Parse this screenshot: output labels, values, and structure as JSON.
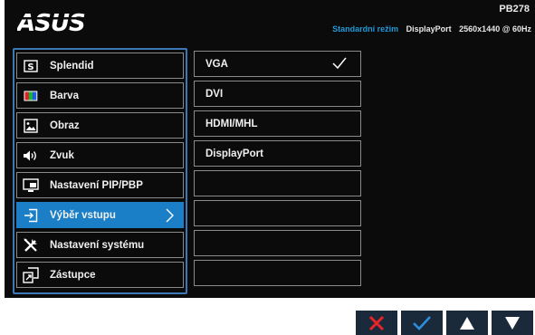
{
  "brand": "ASUS",
  "model": "PB278",
  "status": {
    "mode": "Standardní režim",
    "input": "DisplayPort",
    "resolution": "2560x1440 @ 60Hz"
  },
  "menu": {
    "items": [
      {
        "label": "Splendid",
        "icon": "splendid-icon"
      },
      {
        "label": "Barva",
        "icon": "color-icon"
      },
      {
        "label": "Obraz",
        "icon": "image-icon"
      },
      {
        "label": "Zvuk",
        "icon": "speaker-icon"
      },
      {
        "label": "Nastavení PIP/PBP",
        "icon": "pip-icon"
      },
      {
        "label": "Výběr vstupu",
        "icon": "input-select-icon"
      },
      {
        "label": "Nastavení systému",
        "icon": "tools-icon"
      },
      {
        "label": "Zástupce",
        "icon": "shortcut-icon"
      }
    ],
    "selected_index": 5
  },
  "submenu": {
    "items": [
      {
        "label": "VGA",
        "checked": true
      },
      {
        "label": "DVI",
        "checked": false
      },
      {
        "label": "HDMI/MHL",
        "checked": false
      },
      {
        "label": "DisplayPort",
        "checked": false
      },
      {
        "label": "",
        "checked": false
      },
      {
        "label": "",
        "checked": false
      },
      {
        "label": "",
        "checked": false
      },
      {
        "label": "",
        "checked": false
      }
    ]
  },
  "buttons": [
    {
      "name": "close-icon",
      "color": "#e8232b"
    },
    {
      "name": "check-icon",
      "color": "#2b8fe0"
    },
    {
      "name": "up-arrow-icon",
      "color": "#ffffff"
    },
    {
      "name": "down-arrow-icon",
      "color": "#ffffff"
    }
  ],
  "colors": {
    "accent": "#1a7fc7",
    "status_mode": "#1f9ad8",
    "background": "#0b0b0b",
    "button_bg": "#1b2a3b",
    "close_red": "#e8232b"
  }
}
